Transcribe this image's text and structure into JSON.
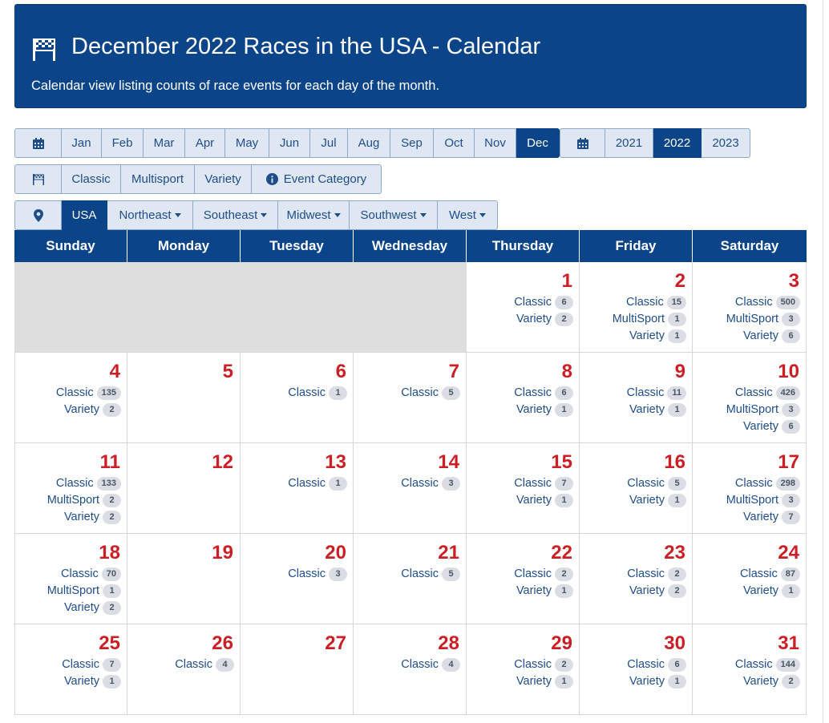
{
  "header": {
    "title": "December 2022 Races in the USA - Calendar",
    "subtitle": "Calendar view listing counts of race events for each day of the month."
  },
  "months": [
    {
      "label": "Jan",
      "active": false
    },
    {
      "label": "Feb",
      "active": false
    },
    {
      "label": "Mar",
      "active": false
    },
    {
      "label": "Apr",
      "active": false
    },
    {
      "label": "May",
      "active": false
    },
    {
      "label": "Jun",
      "active": false
    },
    {
      "label": "Jul",
      "active": false
    },
    {
      "label": "Aug",
      "active": false
    },
    {
      "label": "Sep",
      "active": false
    },
    {
      "label": "Oct",
      "active": false
    },
    {
      "label": "Nov",
      "active": false
    },
    {
      "label": "Dec",
      "active": true
    }
  ],
  "years": [
    {
      "label": "2021",
      "active": false
    },
    {
      "label": "2022",
      "active": true
    },
    {
      "label": "2023",
      "active": false
    }
  ],
  "categories": [
    "Classic",
    "Multisport",
    "Variety"
  ],
  "event_category_label": "Event Category",
  "regions": [
    {
      "label": "USA",
      "active": true,
      "dropdown": false
    },
    {
      "label": "Northeast",
      "active": false,
      "dropdown": true
    },
    {
      "label": "Southeast",
      "active": false,
      "dropdown": true
    },
    {
      "label": "Midwest",
      "active": false,
      "dropdown": true
    },
    {
      "label": "Southwest",
      "active": false,
      "dropdown": true
    },
    {
      "label": "West",
      "active": false,
      "dropdown": true
    }
  ],
  "weekdays": [
    "Sunday",
    "Monday",
    "Tuesday",
    "Wednesday",
    "Thursday",
    "Friday",
    "Saturday"
  ],
  "weeks": [
    [
      null,
      null,
      null,
      null,
      {
        "day": "1",
        "events": [
          [
            "Classic",
            "6"
          ],
          [
            "Variety",
            "2"
          ]
        ]
      },
      {
        "day": "2",
        "events": [
          [
            "Classic",
            "15"
          ],
          [
            "MultiSport",
            "1"
          ],
          [
            "Variety",
            "1"
          ]
        ]
      },
      {
        "day": "3",
        "events": [
          [
            "Classic",
            "500"
          ],
          [
            "MultiSport",
            "3"
          ],
          [
            "Variety",
            "6"
          ]
        ]
      }
    ],
    [
      {
        "day": "4",
        "events": [
          [
            "Classic",
            "135"
          ],
          [
            "Variety",
            "2"
          ]
        ]
      },
      {
        "day": "5",
        "events": []
      },
      {
        "day": "6",
        "events": [
          [
            "Classic",
            "1"
          ]
        ]
      },
      {
        "day": "7",
        "events": [
          [
            "Classic",
            "5"
          ]
        ]
      },
      {
        "day": "8",
        "events": [
          [
            "Classic",
            "6"
          ],
          [
            "Variety",
            "1"
          ]
        ]
      },
      {
        "day": "9",
        "events": [
          [
            "Classic",
            "11"
          ],
          [
            "Variety",
            "1"
          ]
        ]
      },
      {
        "day": "10",
        "events": [
          [
            "Classic",
            "426"
          ],
          [
            "MultiSport",
            "3"
          ],
          [
            "Variety",
            "6"
          ]
        ]
      }
    ],
    [
      {
        "day": "11",
        "events": [
          [
            "Classic",
            "133"
          ],
          [
            "MultiSport",
            "2"
          ],
          [
            "Variety",
            "2"
          ]
        ]
      },
      {
        "day": "12",
        "events": []
      },
      {
        "day": "13",
        "events": [
          [
            "Classic",
            "1"
          ]
        ]
      },
      {
        "day": "14",
        "events": [
          [
            "Classic",
            "3"
          ]
        ]
      },
      {
        "day": "15",
        "events": [
          [
            "Classic",
            "7"
          ],
          [
            "Variety",
            "1"
          ]
        ]
      },
      {
        "day": "16",
        "events": [
          [
            "Classic",
            "5"
          ],
          [
            "Variety",
            "1"
          ]
        ]
      },
      {
        "day": "17",
        "events": [
          [
            "Classic",
            "298"
          ],
          [
            "MultiSport",
            "3"
          ],
          [
            "Variety",
            "7"
          ]
        ]
      }
    ],
    [
      {
        "day": "18",
        "events": [
          [
            "Classic",
            "70"
          ],
          [
            "MultiSport",
            "1"
          ],
          [
            "Variety",
            "2"
          ]
        ]
      },
      {
        "day": "19",
        "events": []
      },
      {
        "day": "20",
        "events": [
          [
            "Classic",
            "3"
          ]
        ]
      },
      {
        "day": "21",
        "events": [
          [
            "Classic",
            "5"
          ]
        ]
      },
      {
        "day": "22",
        "events": [
          [
            "Classic",
            "2"
          ],
          [
            "Variety",
            "1"
          ]
        ]
      },
      {
        "day": "23",
        "events": [
          [
            "Classic",
            "2"
          ],
          [
            "Variety",
            "2"
          ]
        ]
      },
      {
        "day": "24",
        "events": [
          [
            "Classic",
            "87"
          ],
          [
            "Variety",
            "1"
          ]
        ]
      }
    ],
    [
      {
        "day": "25",
        "events": [
          [
            "Classic",
            "7"
          ],
          [
            "Variety",
            "1"
          ]
        ]
      },
      {
        "day": "26",
        "events": [
          [
            "Classic",
            "4"
          ]
        ]
      },
      {
        "day": "27",
        "events": []
      },
      {
        "day": "28",
        "events": [
          [
            "Classic",
            "4"
          ]
        ]
      },
      {
        "day": "29",
        "events": [
          [
            "Classic",
            "2"
          ],
          [
            "Variety",
            "1"
          ]
        ]
      },
      {
        "day": "30",
        "events": [
          [
            "Classic",
            "6"
          ],
          [
            "Variety",
            "1"
          ]
        ]
      },
      {
        "day": "31",
        "events": [
          [
            "Classic",
            "144"
          ],
          [
            "Variety",
            "2"
          ]
        ]
      }
    ]
  ],
  "colors": {
    "primary": "#0b4488",
    "day_number": "#cc1f25",
    "button_bg": "#dfe7f2"
  }
}
